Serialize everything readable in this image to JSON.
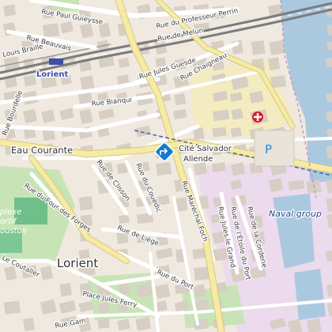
{
  "map": {
    "city": "Lorient",
    "station": "Lorient",
    "districts": {
      "eau_courante": "Eau Courante"
    },
    "area_labels": {
      "naval_group": "Naval group"
    },
    "poi": {
      "line1": "Cité Salvador",
      "line2": "Allende"
    },
    "park_fragments": {
      "a": "plexe",
      "b": "ortif",
      "c": "oustoir"
    },
    "parking_symbol": "P",
    "streets": {
      "paul_guieysse": "Rue Paul Guieysse",
      "professeur_perrin": "Rue du Professeur Perrin",
      "de_melun": "Rue de Melun",
      "beauvais": "Rue Beauvais",
      "louis_braille": "Louis Braille",
      "jules_guesde": "Rue Jules Guesde",
      "chaigneau": "Rue Chaigneau",
      "bianqui": "Rue Bianqui",
      "bourdelle": "Rue Bourdelle",
      "de_clisson": "Rue de Clisson",
      "du_couedic": "Rue du Couëdic",
      "du_four_des_forges": "Rue du Four des Forges",
      "marechal_foch": "Rue Maréchal Foch",
      "jules_le_grand": "Rue Jules le Grand",
      "de_l_etoile_du_port": "Rue de l'Étoile du Port",
      "de_la_corderie": "Rue de la Corderie",
      "de_liege": "Rue de Liège",
      "du_port": "Rue du Port",
      "le_coutaller": "Le Coutaller",
      "place_jules_ferry": "Place Jules Ferry",
      "rue_gam": "Rue Gam"
    }
  },
  "colors": {
    "land": "#efe9e0",
    "building": "#d7cec4",
    "water": "#aac9df",
    "park": "#bfe1ae",
    "pitch": "#6fbf8a",
    "industrial": "#ead9ec",
    "hospital": "#f6efbd",
    "rail": "#8a8a8a",
    "road_major": "#f5ea9f",
    "road": "#ffffff",
    "poi_marker": "#1479d2",
    "hospital_marker": "#d81e2d",
    "parking": "#2b8bd1"
  },
  "icons": {
    "poi": "diamond-direction-icon",
    "hospital": "cross-icon",
    "parking": "parking-icon",
    "station": "train-station-icon"
  }
}
